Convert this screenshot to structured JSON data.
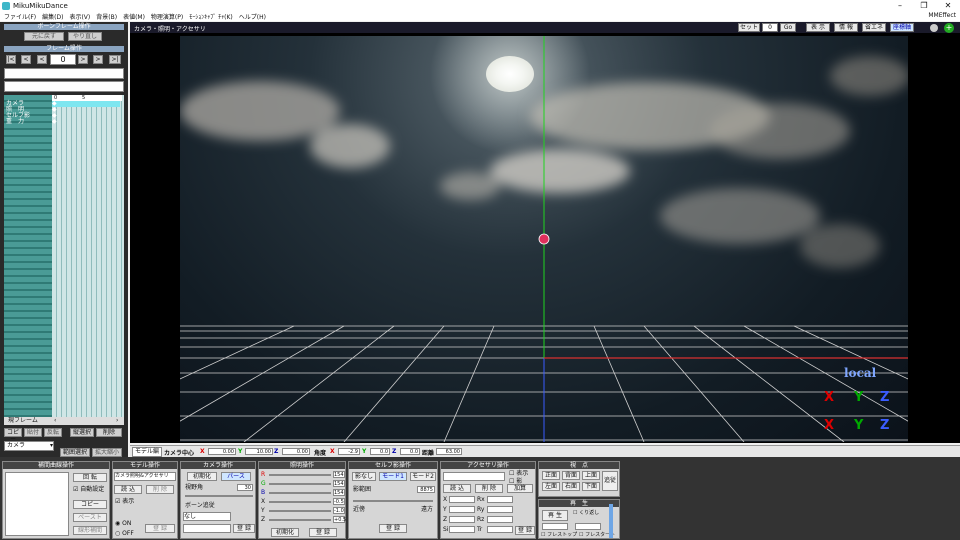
{
  "window": {
    "title": "MikuMikuDance",
    "mmeffect": "MMEffect"
  },
  "menu": [
    "ファイル(F)",
    "編集(D)",
    "表示(V)",
    "背景(B)",
    "表値(M)",
    "物理演算(P)",
    "ﾓｰｼｮﾝｷｬﾌﾟ ﾁｬ(K)",
    "ヘルプ(H)"
  ],
  "left": {
    "bone_frame_title": "ボーンフレーム操作",
    "undo": "元に戻す",
    "redo": "やり直し",
    "frame_title": "フレーム操作",
    "frame_value": "0",
    "nav": [
      "|<",
      "<",
      "<",
      ">",
      ">",
      ">|"
    ],
    "tracks": [
      "カメラ",
      "照　明",
      "セルフ影",
      "重　力"
    ],
    "tick_labels": [
      "0",
      "5"
    ],
    "frame_select": "現フレーム",
    "copy": "コピー",
    "paste_labels": [
      "貼付",
      "反転"
    ],
    "range_select": "範囲選択",
    "select_all": "縦選択",
    "delete": "削除",
    "expand": "拡大縮小",
    "camera_dropdown": "カメラ"
  },
  "viewport": {
    "header_title": "カメラ・照明・アクセサリ",
    "set_label": "セット",
    "set_value": "0",
    "go_label": "Go",
    "buttons": [
      "表 示",
      "情 報",
      "省エネ",
      "座標軸"
    ],
    "local_label": "local"
  },
  "camrow": {
    "model_edit": "モデル編",
    "camera_center": "カメラ中心",
    "cx": "0.00",
    "cy": "10.00",
    "cz": "0.00",
    "angle": "角度",
    "ax": "-2.9",
    "ay": "0.0",
    "az": "0.0",
    "distance": "距離",
    "dist": "63.00"
  },
  "bottom": {
    "interp_title": "補間曲線操作",
    "rotation_label": "回 転",
    "auto_label": "自動設定",
    "copy": "コピー",
    "paste": "ペースト",
    "linear": "線形補間",
    "model_title": "モデル操作",
    "model_value": "カメラ照明&アクセサリ",
    "load": "読 込",
    "del_model": "削 除",
    "play_label": "表示",
    "on": "ON",
    "off": "OFF",
    "register": "登 録",
    "camera_title": "カメラ操作",
    "init": "初期化",
    "perspective": "パース",
    "view_angle": "視野角",
    "view_angle_value": "30",
    "bone_follow": "ボーン追従",
    "none_value": "なし",
    "lighting_title": "照明操作",
    "light_r": "154",
    "light_g": "154",
    "light_b": "154",
    "light_x": "-0.5",
    "light_y": "-1.0",
    "light_z": "+0.5",
    "light_init": "初期化",
    "selfshadow_title": "セルフ影操作",
    "shadow_none": "影なし",
    "mode1": "モード1",
    "mode2": "モード2",
    "shadow_range": "影範囲",
    "shadow_value": "8875",
    "near": "近傍",
    "far": "遠方",
    "accessory_title": "アクセサリ操作",
    "acc_load": "読 込",
    "acc_del": "削 除",
    "acc_show": "表示",
    "acc_shadow": "影",
    "acc_add": "加算",
    "axis_labels": [
      "X",
      "Y",
      "Z",
      "Rx",
      "Ry",
      "Rz",
      "Si",
      "Tr"
    ],
    "viewpoint_title": "視　点",
    "vp_buttons": [
      "正面",
      "背面",
      "上面",
      "左面",
      "右面",
      "下面"
    ],
    "follow": "追従",
    "playback_title": "再　生",
    "play": "再 生",
    "repeat": "くり返し",
    "frame_stop": "フレストップ",
    "frame_start": "フレスタート"
  }
}
